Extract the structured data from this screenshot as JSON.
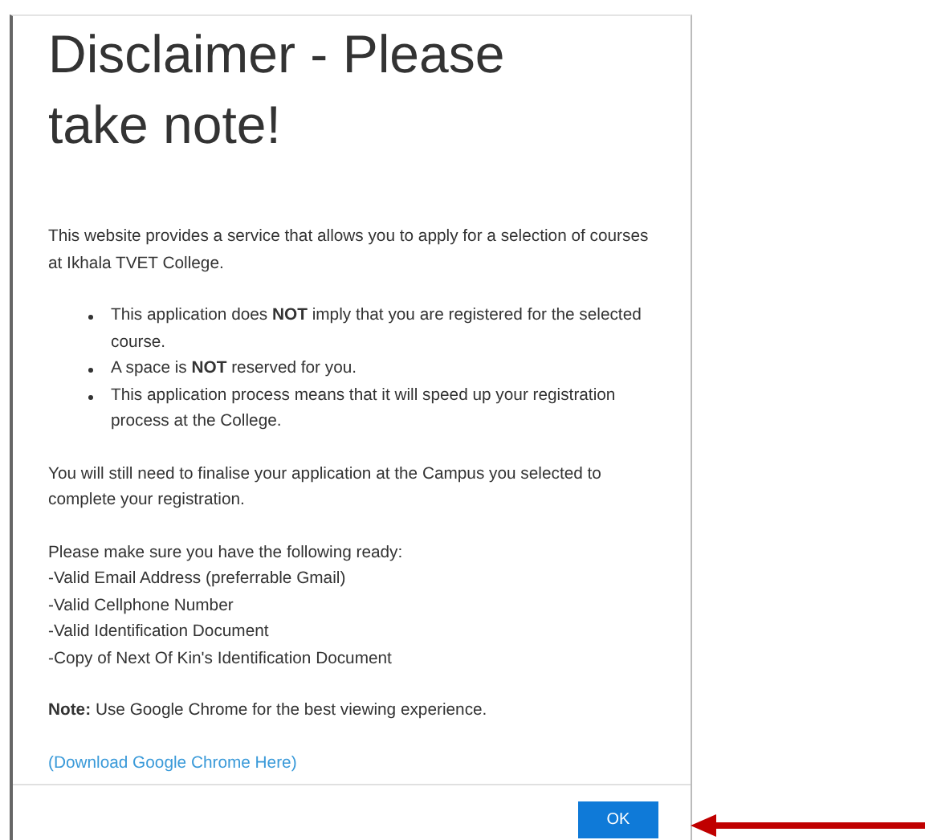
{
  "dialog": {
    "title": "Disclaimer - Please take note!",
    "intro": "This website provides a service that allows you to apply for a selection of courses at Ikhala TVET College.",
    "bullets": [
      "This application does **NOT** imply that you are registered for the selected course.",
      "A space is **NOT** reserved for you.",
      "This application process means that it will speed up your registration process at the College."
    ],
    "finalise": "You will still need to finalise your application at the Campus you selected to complete your registration.",
    "requirements_heading": "Please make sure you have the following ready:",
    "requirements": [
      "-Valid Email Address (preferrable Gmail)",
      "-Valid Cellphone Number",
      "-Valid Identification Document",
      "-Copy of Next Of Kin's Identification Document"
    ],
    "note": "**Note:** Use Google Chrome for the best viewing experience.",
    "link": "(Download Google Chrome Here)",
    "ok_button": "OK"
  }
}
